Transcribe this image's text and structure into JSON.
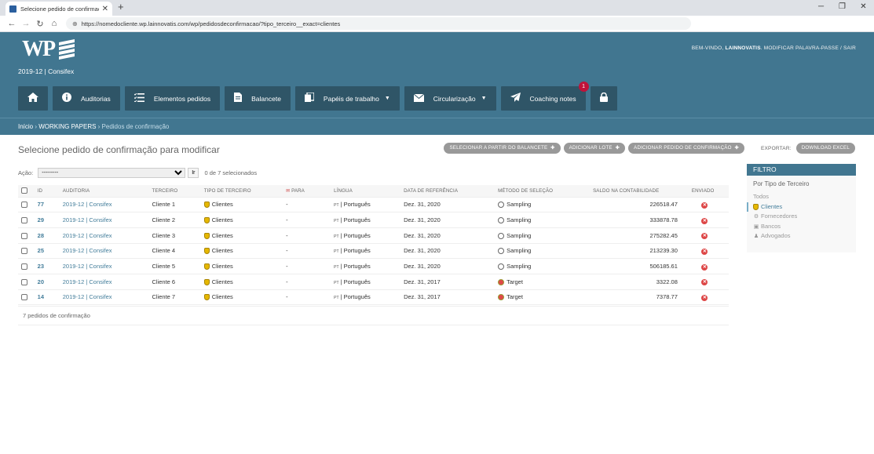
{
  "browser": {
    "tab_title": "Selecione pedido de confirmação",
    "url": "https://nomedocliente.wp.lainnovatis.com/wp/pedidosdeconfirmacao/?tipo_terceiro__exact=clientes"
  },
  "header": {
    "logo_text": "WP",
    "user_welcome": "BEM-VINDO,",
    "user_name": "LAINNOVATIS",
    "user_links": ". MODIFICAR PALAVRA-PASSE / SAIR",
    "site_name": "2019-12 | Consifex",
    "nav": [
      {
        "label": "",
        "icon": "home-icon"
      },
      {
        "label": "Auditorias",
        "icon": "info-icon"
      },
      {
        "label": "Elementos pedidos",
        "icon": "list-icon"
      },
      {
        "label": "Balancete",
        "icon": "document-icon"
      },
      {
        "label": "Papéis de trabalho",
        "icon": "copy-icon"
      },
      {
        "label": "Circularização",
        "icon": "envelope-icon"
      },
      {
        "label": "Coaching notes",
        "icon": "paper-plane-icon",
        "badge": "1"
      },
      {
        "label": "",
        "icon": "lock-icon"
      }
    ],
    "breadcrumbs": {
      "home": "Início",
      "section": "WORKING PAPERS",
      "current": "Pedidos de confirmação"
    }
  },
  "content": {
    "title": "Selecione pedido de confirmação para modificar",
    "tools": {
      "select_balancete": "SELECIONAR A PARTIR DO BALANCETE",
      "add_lote": "ADICIONAR LOTE",
      "add_pedido": "ADICIONAR PEDIDO DE CONFIRMAÇÃO",
      "export_label": "EXPORTAR:",
      "download_excel": "DOWNLOAD EXCEL"
    },
    "actions": {
      "label": "Ação:",
      "selected_option": "---------",
      "go": "Ir",
      "count": "0 de 7 selecionados"
    },
    "columns": {
      "id": "ID",
      "auditoria": "AUDITORIA",
      "terceiro": "TERCEIRO",
      "tipo": "TIPO DE TERCEIRO",
      "para": "PARA",
      "lingua": "LÍNGUA",
      "data": "DATA DE REFERÊNCIA",
      "metodo": "MÉTODO DE SELEÇÃO",
      "saldo": "SALDO NA CONTABILIDADE",
      "enviado": "ENVIADO"
    },
    "rows": [
      {
        "id": "77",
        "auditoria": "2019-12 | Consifex",
        "terceiro": "Cliente 1",
        "tipo": "Clientes",
        "para": "-",
        "lang_code": "PT",
        "lingua": "| Português",
        "data": "Dez. 31, 2020",
        "metodo": "Sampling",
        "saldo": "226518.47"
      },
      {
        "id": "29",
        "auditoria": "2019-12 | Consifex",
        "terceiro": "Cliente 2",
        "tipo": "Clientes",
        "para": "-",
        "lang_code": "PT",
        "lingua": "| Português",
        "data": "Dez. 31, 2020",
        "metodo": "Sampling",
        "saldo": "333878.78"
      },
      {
        "id": "28",
        "auditoria": "2019-12 | Consifex",
        "terceiro": "Cliente 3",
        "tipo": "Clientes",
        "para": "-",
        "lang_code": "PT",
        "lingua": "| Português",
        "data": "Dez. 31, 2020",
        "metodo": "Sampling",
        "saldo": "275282.45"
      },
      {
        "id": "25",
        "auditoria": "2019-12 | Consifex",
        "terceiro": "Cliente 4",
        "tipo": "Clientes",
        "para": "-",
        "lang_code": "PT",
        "lingua": "| Português",
        "data": "Dez. 31, 2020",
        "metodo": "Sampling",
        "saldo": "213239.30"
      },
      {
        "id": "23",
        "auditoria": "2019-12 | Consifex",
        "terceiro": "Cliente 5",
        "tipo": "Clientes",
        "para": "-",
        "lang_code": "PT",
        "lingua": "| Português",
        "data": "Dez. 31, 2020",
        "metodo": "Sampling",
        "saldo": "506185.61"
      },
      {
        "id": "20",
        "auditoria": "2019-12 | Consifex",
        "terceiro": "Cliente 6",
        "tipo": "Clientes",
        "para": "-",
        "lang_code": "PT",
        "lingua": "| Português",
        "data": "Dez. 31, 2017",
        "metodo": "Target",
        "saldo": "3322.08"
      },
      {
        "id": "14",
        "auditoria": "2019-12 | Consifex",
        "terceiro": "Cliente 7",
        "tipo": "Clientes",
        "para": "-",
        "lang_code": "PT",
        "lingua": "| Português",
        "data": "Dez. 31, 2017",
        "metodo": "Target",
        "saldo": "7378.77"
      }
    ],
    "paginator": "7 pedidos de confirmação"
  },
  "filter": {
    "title": "FILTRO",
    "subtitle": "Por Tipo de Terceiro",
    "options": [
      {
        "label": "Todos",
        "selected": false
      },
      {
        "label": "Clientes",
        "selected": true
      },
      {
        "label": "Fornecedores",
        "selected": false
      },
      {
        "label": "Bancos",
        "selected": false
      },
      {
        "label": "Advogados",
        "selected": false
      }
    ]
  },
  "colors": {
    "header": "#417690",
    "nav_button": "#2f5567",
    "link": "#447e9b",
    "badge": "#c0133a",
    "tool_button": "#999999"
  }
}
